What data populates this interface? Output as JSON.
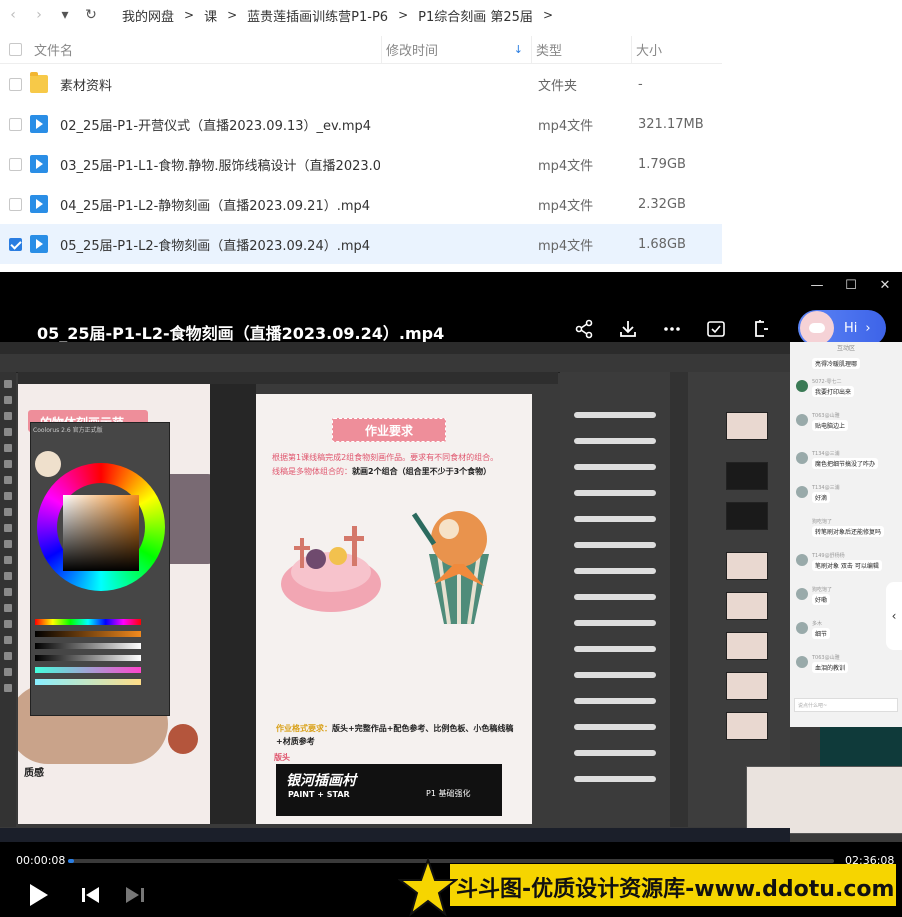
{
  "nav": {
    "back": "‹",
    "forward": "›",
    "dropdown": "▾",
    "refresh": "↻",
    "breadcrumb": [
      "我的网盘",
      "课",
      "蓝贵莲插画训练营P1-P6",
      "P1综合刻画 第25届"
    ],
    "separator": ">"
  },
  "table": {
    "headers": {
      "name": "文件名",
      "time": "修改时间",
      "type": "类型",
      "size": "大小"
    },
    "sort_icon": "↓",
    "rows": [
      {
        "name": "素材资料",
        "type": "文件夹",
        "size": "-",
        "icon": "folder-icon",
        "checked": false,
        "selected": false
      },
      {
        "name": "02_25届-P1-开营仪式（直播2023.09.13）_ev.mp4",
        "type": "mp4文件",
        "size": "321.17MB",
        "icon": "video-file-icon",
        "checked": false,
        "selected": false
      },
      {
        "name": "03_25届-P1-L1-食物.静物.服饰线稿设计（直播2023.09.1...",
        "type": "mp4文件",
        "size": "1.79GB",
        "icon": "video-file-icon",
        "checked": false,
        "selected": false
      },
      {
        "name": "04_25届-P1-L2-静物刻画（直播2023.09.21）.mp4",
        "type": "mp4文件",
        "size": "2.32GB",
        "icon": "video-file-icon",
        "checked": false,
        "selected": false
      },
      {
        "name": "05_25届-P1-L2-食物刻画（直播2023.09.24）.mp4",
        "type": "mp4文件",
        "size": "1.68GB",
        "icon": "video-file-icon",
        "checked": true,
        "selected": true
      }
    ]
  },
  "player": {
    "window_controls": {
      "minimize": "—",
      "maximize": "☐",
      "close": "✕"
    },
    "title": "05_25届-P1-L2-食物刻画（直播2023.09.24）.mp4",
    "tools": {
      "share": "⋔",
      "download": "⤓",
      "more": "•••",
      "screenshot": "⧉",
      "pip": "⊏"
    },
    "hi_label": "Hi",
    "hi_arrow": "›",
    "current_time": "00:00:08",
    "total_time": "02:36:08",
    "progress": 0.001,
    "side_tab": "‹",
    "watermark": "斗斗图-优质设计资源库-www.ddotu.com"
  },
  "video_content": {
    "canvas_a_title": "的物体刻画示范",
    "canvas_a_label": "质感",
    "requirement_title": "作业要求",
    "requirement_line1": "根据第1课线稿完成2组食物刻画作品。要求有不同食材的组合。",
    "requirement_line2_a": "线稿是多物体组合的：",
    "requirement_line2_b": "就画2个组合（组合里不少于3个食物）",
    "format_a": "作业格式要求：",
    "format_b": "版头+完整作品+配色参考、比例色板、小色稿线稿+材质参考",
    "banner_label": "版头",
    "banner_title": "银河插画村",
    "banner_sub": "PAINT + STAR",
    "banner_right": "P1 基础强化",
    "color_panel_title": "Coolorus 2.6 官方正式版",
    "chat_header": "互动区",
    "chat_messages": [
      {
        "name": "",
        "text": "亮得冷暖肌理哪"
      },
      {
        "name": "5072-零七二",
        "text": "我要打印出来"
      },
      {
        "name": "T063@山雅",
        "text": "贴电脑边上"
      },
      {
        "name": "T134@三浦",
        "text": "魔色把细节搞没了咋办"
      },
      {
        "name": "T134@三浦",
        "text": "好滴"
      },
      {
        "name": "狗吃饱了",
        "text": "转笔刷对象后还能修复吗"
      },
      {
        "name": "T149@舒杨杨",
        "text": "笔刷对象 双击 可以编辑"
      },
      {
        "name": "狗吃饱了",
        "text": "好嘞"
      },
      {
        "name": "多木",
        "text": "细节"
      },
      {
        "name": "T063@山雅",
        "text": "血泪的教训"
      }
    ],
    "chat_input_placeholder": "说点什么吧~"
  }
}
